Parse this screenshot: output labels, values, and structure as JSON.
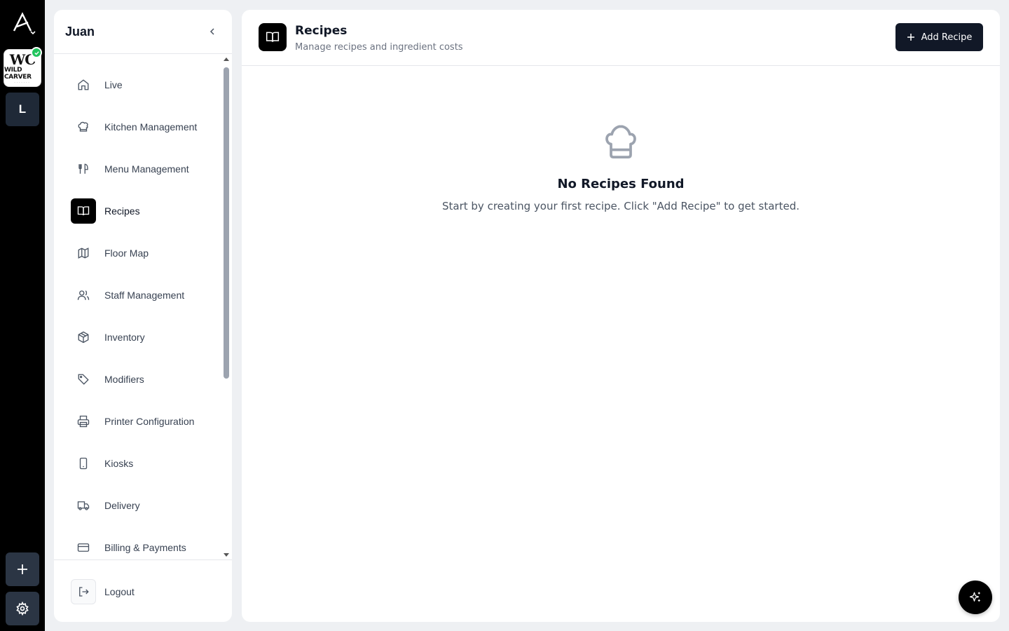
{
  "colors": {
    "rail_bg": "#000000",
    "accent": "#111827",
    "active_nav": "#000000",
    "verified_badge": "#22c55e",
    "page_bg": "#eef0f3"
  },
  "rail": {
    "logo_icon": "app-logo-icon",
    "org": {
      "monogram": "WC",
      "name": "WILD CARVER",
      "verified_icon": "check-badge-icon"
    },
    "location_initial": "L",
    "add_icon": "plus-icon",
    "settings_icon": "gear-icon"
  },
  "sidebar": {
    "title": "Juan",
    "collapse_icon": "chevron-left-icon",
    "items": [
      {
        "label": "Live",
        "icon": "home-icon"
      },
      {
        "label": "Kitchen Management",
        "icon": "chef-hat-icon"
      },
      {
        "label": "Menu Management",
        "icon": "utensils-icon"
      },
      {
        "label": "Recipes",
        "icon": "book-open-icon",
        "active": true
      },
      {
        "label": "Floor Map",
        "icon": "map-icon"
      },
      {
        "label": "Staff Management",
        "icon": "users-icon"
      },
      {
        "label": "Inventory",
        "icon": "package-icon"
      },
      {
        "label": "Modifiers",
        "icon": "tag-icon"
      },
      {
        "label": "Printer Configuration",
        "icon": "printer-icon"
      },
      {
        "label": "Kiosks",
        "icon": "tablet-icon"
      },
      {
        "label": "Delivery",
        "icon": "truck-icon"
      },
      {
        "label": "Billing & Payments",
        "icon": "credit-card-icon"
      }
    ],
    "logout": {
      "label": "Logout",
      "icon": "logout-icon"
    }
  },
  "header": {
    "icon": "book-open-icon",
    "title": "Recipes",
    "subtitle": "Manage recipes and ingredient costs",
    "add_button": "Add Recipe"
  },
  "empty_state": {
    "icon": "chef-hat-icon",
    "title": "No Recipes Found",
    "message": "Start by creating your first recipe. Click \"Add Recipe\" to get started."
  },
  "fab": {
    "icon": "sparkles-icon"
  }
}
